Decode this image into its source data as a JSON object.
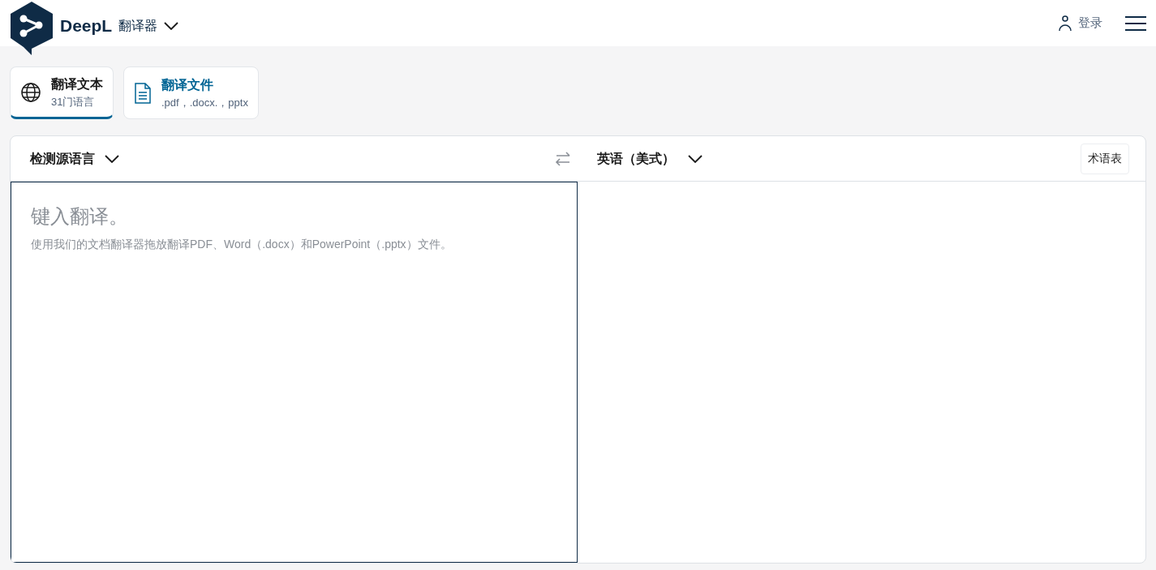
{
  "header": {
    "brand": "DeepL",
    "product": "翻译器",
    "login": "登录"
  },
  "tabs": [
    {
      "kind": "text",
      "title": "翻译文本",
      "subtitle": "31门语言",
      "selected": true
    },
    {
      "kind": "file",
      "title": "翻译文件",
      "subtitle": ".pdf，.docx.，pptx",
      "selected": false
    }
  ],
  "translator": {
    "source_language": "检测源语言",
    "target_language": "英语（美式）",
    "glossary": "术语表",
    "source": {
      "placeholder": "键入翻译。",
      "hint": "使用我们的文档翻译器拖放翻译PDF、Word（.docx）和PowerPoint（.pptx）文件。"
    }
  }
}
